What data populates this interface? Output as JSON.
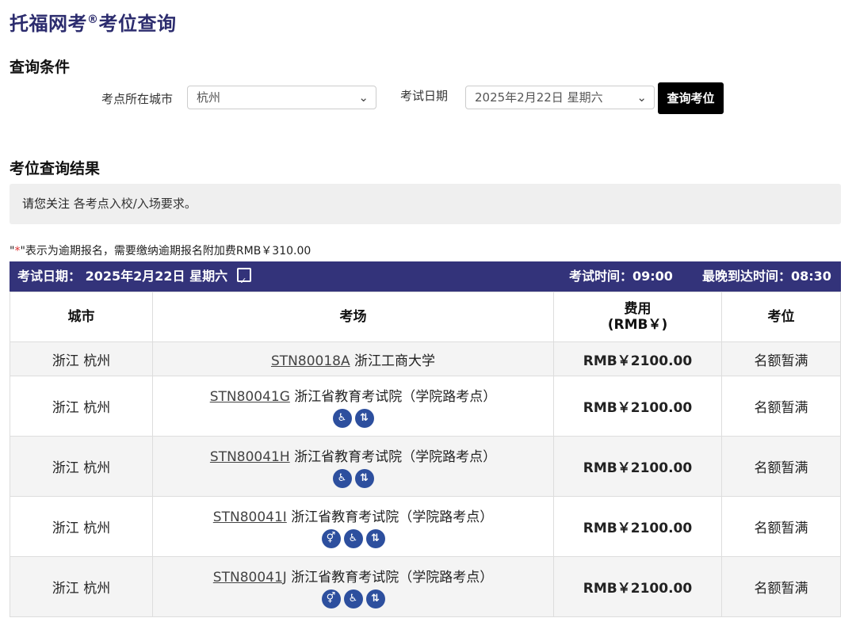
{
  "page": {
    "title": "托福网考",
    "title_mark": "®",
    "title_suffix": "考位查询"
  },
  "filters": {
    "section_title": "查询条件",
    "city_label": "考点所在城市",
    "city_value": "杭州",
    "date_label": "考试日期",
    "date_value": "2025年2月22日 星期六",
    "search_label": "查询考位"
  },
  "results": {
    "section_title": "考位查询结果",
    "notice_prefix": "请您关注",
    "notice_link": "各考点入校/入场要求。",
    "late_note_open": "\"",
    "late_note_ast": "*",
    "late_note_text": "\"表示为逾期报名，需要缴纳逾期报名附加费RMB￥310.00",
    "date_bar": {
      "date_text": "考试日期：  2025年2月22日 星期六",
      "time_text": "考试时间：09:00",
      "latest_text": "最晚到达时间：08:30"
    },
    "columns": {
      "city": "城市",
      "venue": "考场",
      "fee_line1": "费用",
      "fee_line2": "(RMB￥)",
      "seat": "考位"
    },
    "rows": [
      {
        "city": "浙江 杭州",
        "code": "STN80018A",
        "name": "浙江工商大学",
        "icons": [],
        "fee": "RMB￥2100.00",
        "seat": "名额暂满"
      },
      {
        "city": "浙江 杭州",
        "code": "STN80041G",
        "name": "浙江省教育考试院（学院路考点）",
        "icons": [
          "wheelchair-icon",
          "elevator-icon"
        ],
        "fee": "RMB￥2100.00",
        "seat": "名额暂满"
      },
      {
        "city": "浙江 杭州",
        "code": "STN80041H",
        "name": "浙江省教育考试院（学院路考点）",
        "icons": [
          "wheelchair-icon",
          "elevator-icon"
        ],
        "fee": "RMB￥2100.00",
        "seat": "名额暂满"
      },
      {
        "city": "浙江 杭州",
        "code": "STN80041I",
        "name": "浙江省教育考试院（学院路考点）",
        "icons": [
          "restroom-icon",
          "wheelchair-icon",
          "elevator-icon"
        ],
        "fee": "RMB￥2100.00",
        "seat": "名额暂满"
      },
      {
        "city": "浙江 杭州",
        "code": "STN80041J",
        "name": "浙江省教育考试院（学院路考点）",
        "icons": [
          "restroom-icon",
          "wheelchair-icon",
          "elevator-icon"
        ],
        "fee": "RMB￥2100.00",
        "seat": "名额暂满"
      }
    ]
  }
}
